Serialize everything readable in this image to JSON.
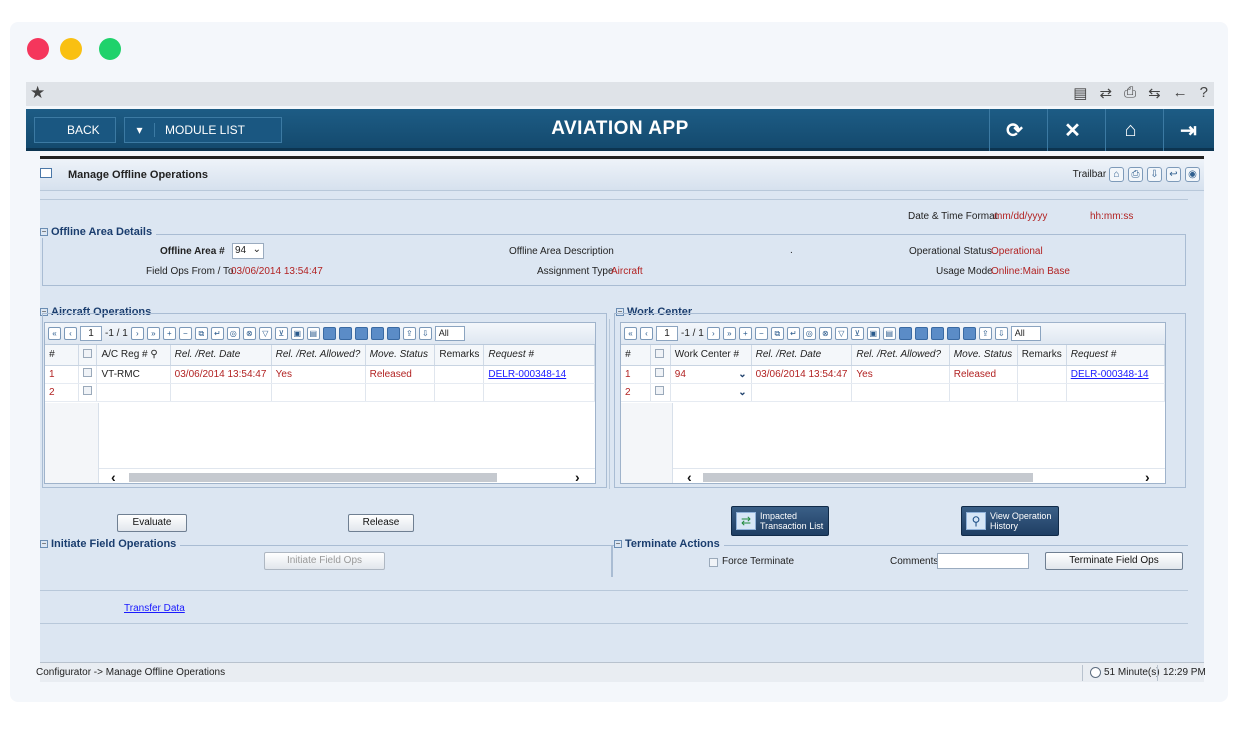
{
  "window": {
    "controls": {
      "close": "#f5365c",
      "minimize": "#f9c012",
      "maximize": "#1fd26b"
    }
  },
  "topstrip": {
    "star": "★",
    "icons": [
      "▤",
      "⇄",
      "⎙",
      "⇆",
      "←",
      "?"
    ]
  },
  "appbar": {
    "back_label": "BACK",
    "module_label": "MODULE LIST",
    "module_caret": "▾",
    "title": "AVIATION APP",
    "refresh_glyph": "⟳",
    "close_glyph": "✕",
    "home_glyph": "⌂",
    "logout_glyph": "⇥"
  },
  "page": {
    "title": "Manage Offline Operations",
    "trailbar_label": "Trailbar ▾",
    "header_icons": [
      "⌂",
      "⎙",
      "⇩",
      "↩",
      "◉"
    ]
  },
  "datetime": {
    "label": "Date & Time Format",
    "date_format": "mm/dd/yyyy",
    "time_format": "hh:mm:ss"
  },
  "offline_area": {
    "section_title": "Offline Area Details",
    "offline_area_label": "Offline Area #",
    "offline_area_value": "94",
    "description_label": "Offline Area Description",
    "description_value": ".",
    "status_label": "Operational Status",
    "status_value": "Operational",
    "field_ops_label": "Field Ops From / To",
    "field_ops_value": "03/06/2014 13:54:47",
    "assignment_label": "Assignment Type",
    "assignment_value": "Aircraft",
    "usage_label": "Usage Mode",
    "usage_value": "Online:Main Base"
  },
  "aircraft_ops": {
    "section_title": "Aircraft Operations",
    "page_current": "1",
    "page_total": "-1 / 1",
    "filter_value": "All",
    "columns": [
      "#",
      "",
      "A/C Reg #",
      "Rel. /Ret. Date",
      "Rel. /Ret. Allowed?",
      "Move. Status",
      "Remarks",
      "Request #"
    ],
    "rows": [
      {
        "num": "1",
        "reg": "VT-RMC",
        "date": "03/06/2014 13:54:47",
        "allowed": "Yes",
        "status": "Released",
        "remarks": "",
        "request": "DELR-000348-14"
      },
      {
        "num": "2",
        "reg": "",
        "date": "",
        "allowed": "",
        "status": "",
        "remarks": "",
        "request": ""
      }
    ]
  },
  "work_center": {
    "section_title": "Work Center",
    "page_current": "1",
    "page_total": "-1 / 1",
    "filter_value": "All",
    "columns": [
      "#",
      "",
      "Work Center #",
      "Rel. /Ret. Date",
      "Rel. /Ret. Allowed?",
      "Move. Status",
      "Remarks",
      "Request #"
    ],
    "rows": [
      {
        "num": "1",
        "wc": "94",
        "date": "03/06/2014 13:54:47",
        "allowed": "Yes",
        "status": "Released",
        "remarks": "",
        "request": "DELR-000348-14"
      },
      {
        "num": "2",
        "wc": "",
        "date": "",
        "allowed": "",
        "status": "",
        "remarks": "",
        "request": ""
      }
    ]
  },
  "actions": {
    "evaluate": "Evaluate",
    "release": "Release",
    "impacted": "Impacted Transaction List",
    "view_history": "View Operation History"
  },
  "initiate": {
    "section_title": "Initiate Field Operations",
    "button": "Initiate Field Ops"
  },
  "terminate": {
    "section_title": "Terminate Actions",
    "force_label": "Force Terminate",
    "comments_label": "Comments",
    "comments_value": "",
    "button": "Terminate Field Ops"
  },
  "transfer_link": "Transfer Data",
  "statusbar": {
    "breadcrumb": "Configurator -> Manage Offline Operations",
    "session": "51 Minute(s)",
    "time": "12:29 PM"
  }
}
